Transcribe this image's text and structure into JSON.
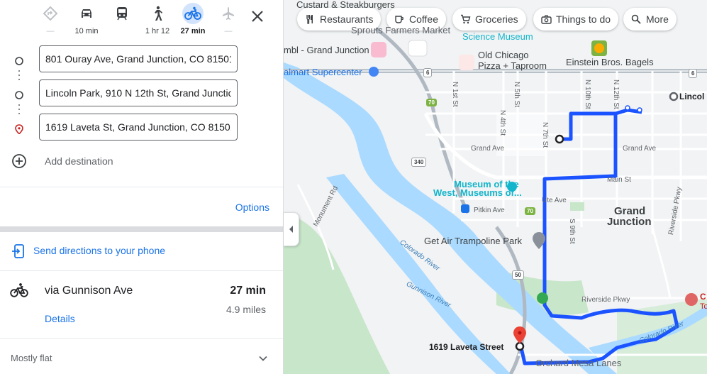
{
  "travel_modes": [
    {
      "name": "best",
      "label": "—"
    },
    {
      "name": "driving",
      "label": "10 min"
    },
    {
      "name": "transit",
      "label": ""
    },
    {
      "name": "walking",
      "label": "1 hr 12"
    },
    {
      "name": "cycling",
      "label": "27 min"
    },
    {
      "name": "flights",
      "label": "—"
    }
  ],
  "stops": [
    {
      "value": "801 Ouray Ave, Grand Junction, CO 81501"
    },
    {
      "value": "Lincoln Park, 910 N 12th St, Grand Junction"
    },
    {
      "value": "1619 Laveta St, Grand Junction, CO 81501"
    }
  ],
  "add_destination": "Add destination",
  "options_label": "Options",
  "send_directions": "Send directions to your phone",
  "route": {
    "via": "via Gunnison Ave",
    "duration": "27 min",
    "distance": "4.9 miles",
    "details_label": "Details",
    "terrain": "Mostly flat"
  },
  "map": {
    "chips": [
      {
        "icon": "utensils-icon",
        "label": "Restaurants"
      },
      {
        "icon": "coffee-icon",
        "label": "Coffee"
      },
      {
        "icon": "cart-icon",
        "label": "Groceries"
      },
      {
        "icon": "camera-icon",
        "label": "Things to do"
      },
      {
        "icon": "search-icon",
        "label": "More"
      }
    ],
    "labels": {
      "custard": "Custard & Steakburgers",
      "sprouts": "Sprouts Farmers Market",
      "science": "Science Museum",
      "mbl": "mbl - Grand Junction",
      "walmart": "almart Supercenter",
      "old_chicago": "Old Chicago",
      "old_chicago2": "Pizza + Taproom",
      "einstein": "Einstein Bros. Bagels",
      "lincoln": "Lincol",
      "museum1": "Museum of the",
      "museum2": "West, Museums of...",
      "pitkin": "Pitkin Ave",
      "ute": "Ute Ave",
      "main": "Main St",
      "grand_ave_w": "Grand Ave",
      "grand_ave_e": "Grand Ave",
      "city1": "Grand",
      "city2": "Junction",
      "trampoline": "Get Air Trampoline Park",
      "monument": "Monument Rd",
      "colorado_river": "Colorado River",
      "gunnison_river": "Gunnison River",
      "colorado_river2": "Colorado River",
      "riverside": "Riverside Pkwy",
      "laveta": "1619 Laveta Street",
      "orchard": "Orchard Mesa Lanes",
      "n1st": "N 1st St",
      "n4th": "N 4th St",
      "n5th": "N 5th St",
      "n7th": "N 7th St",
      "n10th": "N 10th St",
      "n12th": "N 12th St",
      "s9th": "S 9th St",
      "pkwy": "Riverside Pkwy",
      "c_right": "C",
      "to_right": "To"
    },
    "shields": {
      "us6a": "6",
      "us6b": "6",
      "r70": "70",
      "r340": "340",
      "r70b": "70",
      "r50": "50"
    },
    "colors": {
      "route": "#1a53ff",
      "river": "#aadaff",
      "park": "#c8e6c9",
      "road": "#ffffff",
      "highway": "#b0b8c1"
    }
  }
}
